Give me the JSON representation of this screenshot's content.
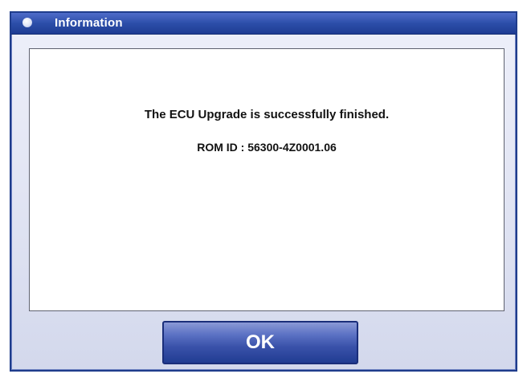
{
  "dialog": {
    "title": "Information",
    "icon": "info-bullet-icon"
  },
  "content": {
    "message": "The ECU Upgrade is successfully finished.",
    "rom_id": "ROM ID : 56300-4Z0001.06"
  },
  "buttons": {
    "ok_label": "OK"
  },
  "colors": {
    "titlebar": "#2c4ea9",
    "button": "#3a52aa",
    "panel": "#e3e6f4"
  }
}
